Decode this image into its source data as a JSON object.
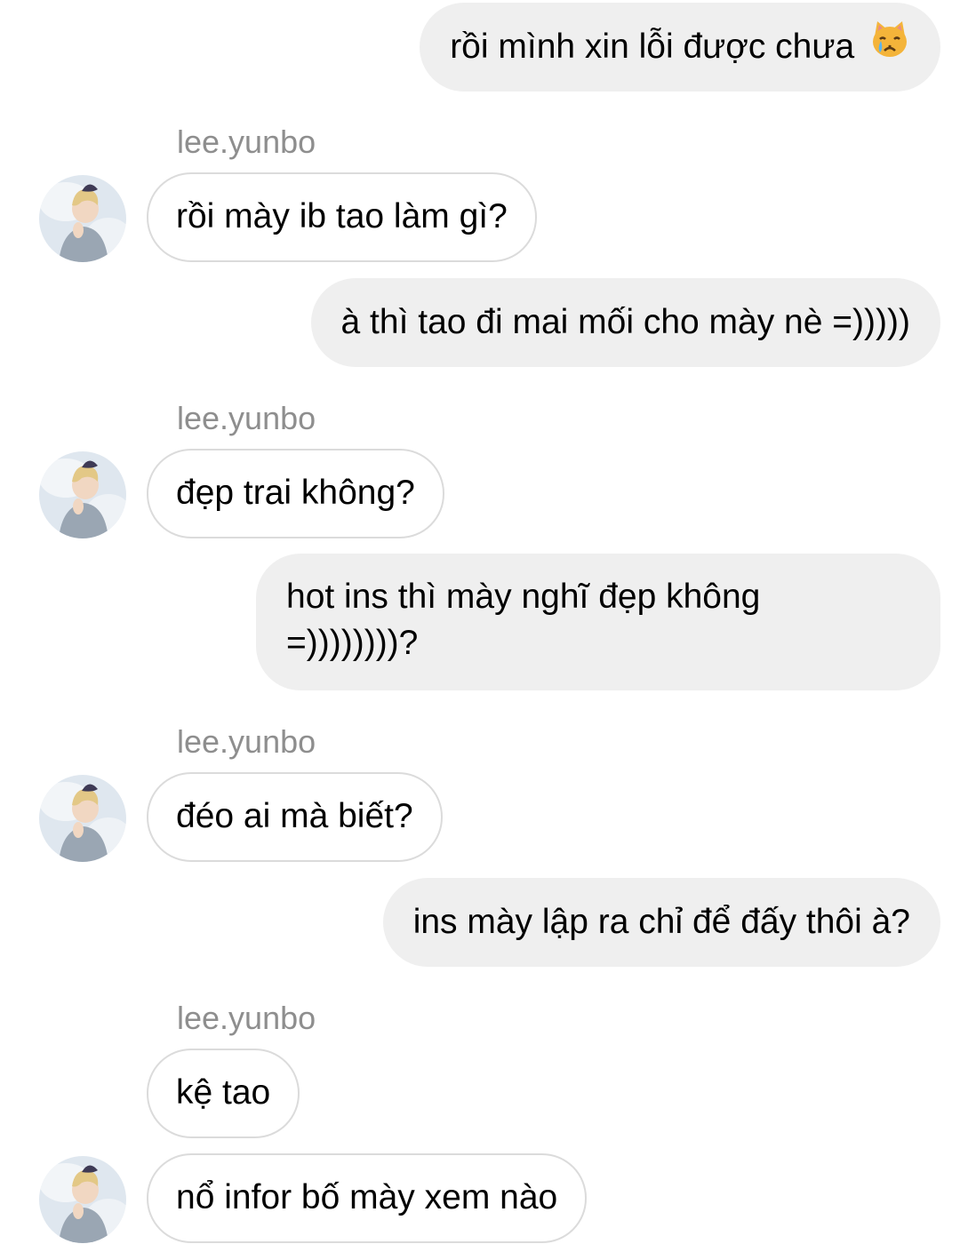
{
  "chat": {
    "sender_name": "lee.yunbo",
    "avatar_icon": "profile-avatar",
    "messages": [
      {
        "from": "me",
        "text": "rồi mình xin lỗi được chưa",
        "emoji_icon": "crying-cat-emoji"
      },
      {
        "from": "lee.yunbo",
        "text": "rồi mày ib tao làm gì?"
      },
      {
        "from": "me",
        "text": "à thì tao đi mai mối cho mày nè =)))))"
      },
      {
        "from": "lee.yunbo",
        "text": "đẹp trai không?"
      },
      {
        "from": "me",
        "line1": "hot ins thì mày nghĩ đẹp không",
        "line2": "=))))))))?"
      },
      {
        "from": "lee.yunbo",
        "text": "đéo ai mà biết?"
      },
      {
        "from": "me",
        "text": "ins mày lập ra chỉ để đấy thôi à?"
      },
      {
        "from": "lee.yunbo",
        "text": "kệ tao"
      },
      {
        "from": "lee.yunbo",
        "text": "nổ infor bố mày xem nào"
      }
    ]
  }
}
